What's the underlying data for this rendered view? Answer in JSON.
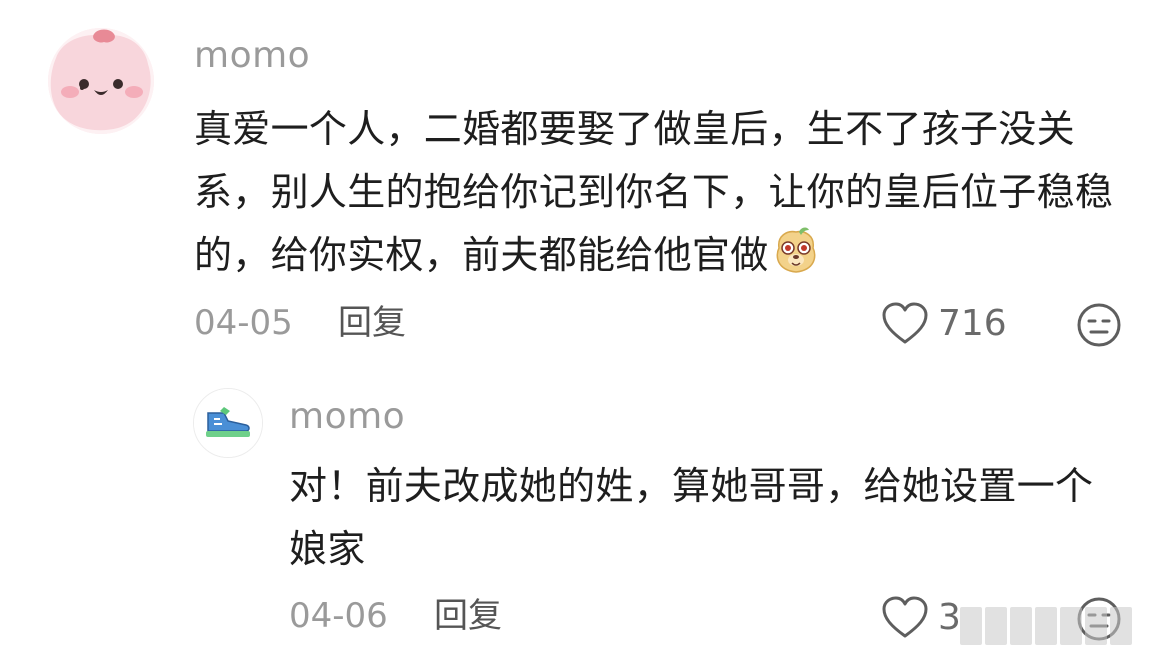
{
  "comments": [
    {
      "username": "momo",
      "text": "真爱一个人，二婚都要娶了做皇后，生不了孩子没关系，别人生的抱给你记到你名下，让你的皇后位子稳稳的，给你实权，前夫都能给他官做",
      "emoji": "dog-face-emoji",
      "date": "04-05",
      "reply_label": "回复",
      "like_count": "716",
      "avatar": "pink-blob-avatar"
    },
    {
      "username": "momo",
      "text": "对！前夫改成她的姓，算她哥哥，给她设置一个娘家",
      "date": "04-06",
      "reply_label": "回复",
      "like_count": "3",
      "avatar": "sneaker-avatar"
    }
  ],
  "icons": {
    "like": "heart-outline-icon",
    "dislike": "meh-face-icon"
  },
  "colors": {
    "meta_gray": "#9a9a9a",
    "text": "#1e1e1e",
    "avatar_pink": "#f4b8c3"
  }
}
